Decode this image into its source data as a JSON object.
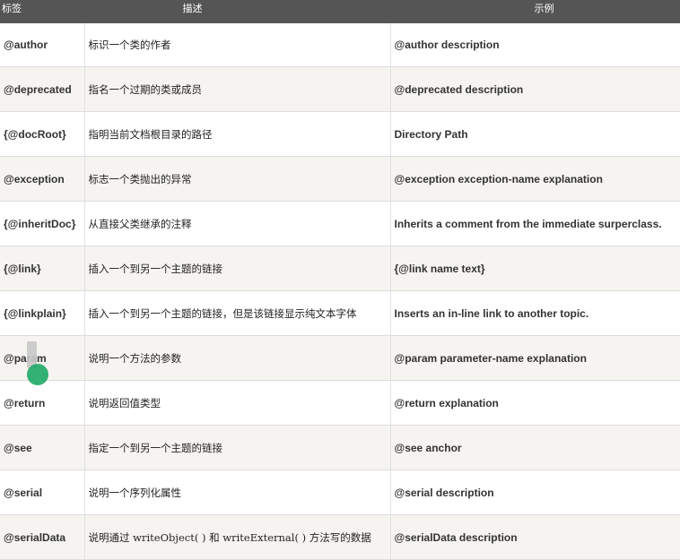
{
  "table": {
    "headers": {
      "tag": "标签",
      "desc": "描述",
      "example": "示例"
    },
    "rows": [
      {
        "tag": "@author",
        "desc": "标识一个类的作者",
        "example": "@author description"
      },
      {
        "tag": "@deprecated",
        "desc": "指名一个过期的类或成员",
        "example": "@deprecated description"
      },
      {
        "tag": "{@docRoot}",
        "desc": "指明当前文档根目录的路径",
        "example": "Directory Path"
      },
      {
        "tag": "@exception",
        "desc": "标志一个类抛出的异常",
        "example": "@exception exception-name explanation"
      },
      {
        "tag": "{@inheritDoc}",
        "desc": "从直接父类继承的注释",
        "example": "Inherits a comment from the immediate surperclass."
      },
      {
        "tag": "{@link}",
        "desc": "插入一个到另一个主题的链接",
        "example": "{@link name text}"
      },
      {
        "tag": "{@linkplain}",
        "desc": "插入一个到另一个主题的链接，但是该链接显示纯文本字体",
        "example": "Inserts an in-line link to another topic."
      },
      {
        "tag": "@param",
        "desc": "说明一个方法的参数",
        "example": "@param parameter-name explanation"
      },
      {
        "tag": "@return",
        "desc": "说明返回值类型",
        "example": "@return explanation"
      },
      {
        "tag": "@see",
        "desc": "指定一个到另一个主题的链接",
        "example": "@see anchor"
      },
      {
        "tag": "@serial",
        "desc": "说明一个序列化属性",
        "example": "@serial description"
      },
      {
        "tag": "@serialData",
        "desc": "说明通过 writeObject( ) 和 writeExternal( ) 方法写的数据",
        "example": "@serialData description"
      }
    ]
  }
}
